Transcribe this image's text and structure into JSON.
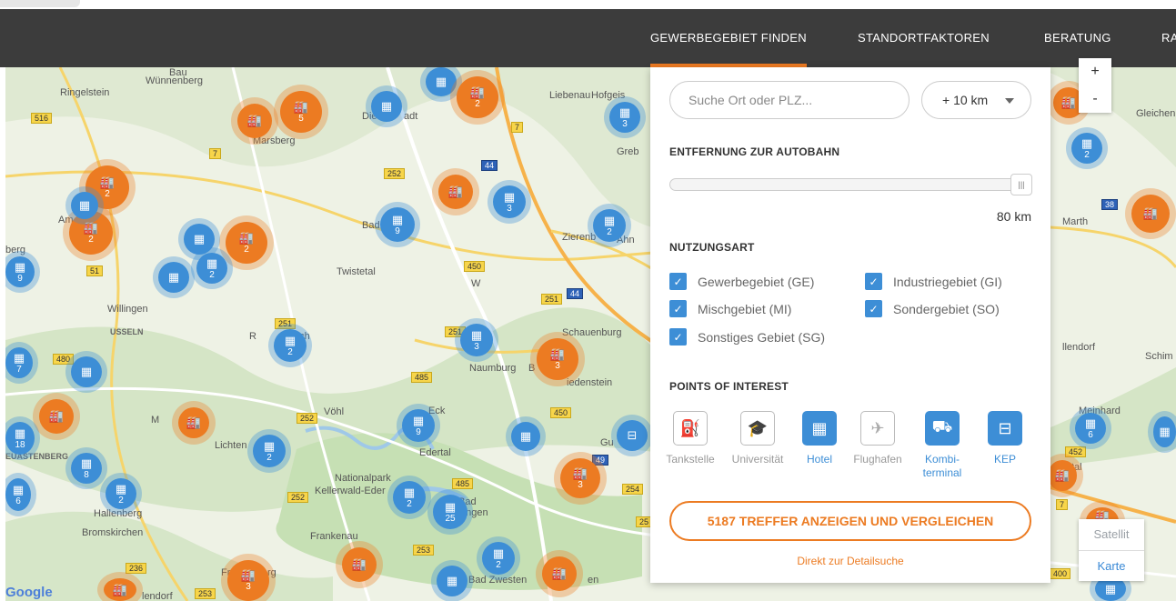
{
  "nav": {
    "items": [
      {
        "label": "GEWERBEGEBIET FINDEN",
        "active": true
      },
      {
        "label": "STANDORTFAKTOREN"
      },
      {
        "label": "BERATUNG"
      },
      {
        "label": "RA"
      }
    ]
  },
  "search": {
    "placeholder": "Suche Ort oder PLZ...",
    "radius": "+ 10 km"
  },
  "distance": {
    "title": "ENTFERNUNG ZUR AUTOBAHN",
    "handle": "|||",
    "value_label": "80 km",
    "fraction": 1.0
  },
  "usage": {
    "title": "NUTZUNGSART",
    "options": [
      {
        "label": "Gewerbegebiet (GE)",
        "checked": true
      },
      {
        "label": "Industriegebiet (GI)",
        "checked": true
      },
      {
        "label": "Mischgebiet (MI)",
        "checked": true
      },
      {
        "label": "Sondergebiet (SO)",
        "checked": true
      },
      {
        "label": "Sonstiges Gebiet (SG)",
        "checked": true
      }
    ]
  },
  "poi": {
    "title": "POINTS OF INTEREST",
    "items": [
      {
        "label": "Tankstelle",
        "active": false,
        "icon": "fuel-pump-icon"
      },
      {
        "label": "Universität",
        "active": false,
        "icon": "graduation-cap-icon"
      },
      {
        "label": "Hotel",
        "active": true,
        "icon": "hotel-icon"
      },
      {
        "label": "Flughafen",
        "active": false,
        "icon": "airplane-icon"
      },
      {
        "label": "Kombi-terminal",
        "line1": "Kombi-",
        "line2": "terminal",
        "active": true,
        "icon": "truck-icon"
      },
      {
        "label": "KEP",
        "active": true,
        "icon": "parcel-icon"
      }
    ]
  },
  "cta": {
    "label": "5187 TREFFER ANZEIGEN UND VERGLEICHEN"
  },
  "detail_link": {
    "label": "Direkt zur Detailsuche"
  },
  "map": {
    "zoom_in": "+",
    "zoom_out": "-",
    "type_satellite": "Satellit",
    "type_map": "Karte",
    "logo": "Google",
    "places": [
      "Bau",
      "Wünnenberg",
      "Ringelstein",
      "Liebenau",
      "Hofgeis",
      "Gleichen",
      "Marsberg",
      "Die",
      "adt",
      "Greb",
      "Bad",
      "Zierenb",
      "Ahn",
      "Marth",
      "Twistetal",
      "berg",
      "W",
      "Willingen",
      "USSELN",
      "Schauenburg",
      "ach",
      "llendorf",
      "Schim",
      "Naumburg",
      "B",
      "iedenstein",
      "Vöhl",
      "Eck",
      "Meinhard",
      "Lichten",
      "Edertal",
      "Gu",
      "EUASTENBERG",
      "Nationalpark",
      "Kellerwald-Eder",
      "Bad",
      "ungen",
      "Hallenberg",
      "Bromskirchen",
      "Frankenau",
      "Bad Zwesten",
      "lendorf",
      "Fr",
      "rg",
      "en",
      "Am",
      "R",
      "M",
      "tal"
    ],
    "roads": [
      {
        "label": "516",
        "color": "yellow"
      },
      {
        "label": "7",
        "color": "yellow"
      },
      {
        "label": "252",
        "color": "yellow"
      },
      {
        "label": "44",
        "color": "blue"
      },
      {
        "label": "7",
        "color": "yellow"
      },
      {
        "label": "450",
        "color": "yellow"
      },
      {
        "label": "251",
        "color": "yellow"
      },
      {
        "label": "44",
        "color": "blue"
      },
      {
        "label": "251",
        "color": "yellow"
      },
      {
        "label": "251",
        "color": "yellow"
      },
      {
        "label": "485",
        "color": "yellow"
      },
      {
        "label": "480",
        "color": "yellow"
      },
      {
        "label": "252",
        "color": "yellow"
      },
      {
        "label": "450",
        "color": "yellow"
      },
      {
        "label": "485",
        "color": "yellow"
      },
      {
        "label": "252",
        "color": "yellow"
      },
      {
        "label": "254",
        "color": "yellow"
      },
      {
        "label": "253",
        "color": "yellow"
      },
      {
        "label": "236",
        "color": "yellow"
      },
      {
        "label": "253",
        "color": "yellow"
      },
      {
        "label": "38",
        "color": "blue"
      },
      {
        "label": "452",
        "color": "yellow"
      },
      {
        "label": "7",
        "color": "yellow"
      },
      {
        "label": "400",
        "color": "yellow"
      },
      {
        "label": "51",
        "color": "yellow"
      },
      {
        "label": "49",
        "color": "blue"
      },
      {
        "label": "25",
        "color": "yellow"
      }
    ],
    "markers": [
      {
        "kind": "orange",
        "count": "5"
      },
      {
        "kind": "orange",
        "count": ""
      },
      {
        "kind": "blue",
        "count": ""
      },
      {
        "kind": "blue",
        "count": ""
      },
      {
        "kind": "orange",
        "count": "2"
      },
      {
        "kind": "blue",
        "count": "3"
      },
      {
        "kind": "orange",
        "count": ""
      },
      {
        "kind": "blue",
        "count": "2"
      },
      {
        "kind": "orange",
        "count": "2"
      },
      {
        "kind": "orange",
        "count": "2"
      },
      {
        "kind": "blue",
        "count": ""
      },
      {
        "kind": "orange",
        "count": "2"
      },
      {
        "kind": "blue",
        "count": "9"
      },
      {
        "kind": "orange",
        "count": ""
      },
      {
        "kind": "blue",
        "count": "3"
      },
      {
        "kind": "blue",
        "count": "2"
      },
      {
        "kind": "blue",
        "count": ""
      },
      {
        "kind": "blue",
        "count": "2"
      },
      {
        "kind": "blue",
        "count": ""
      },
      {
        "kind": "blue",
        "count": "9"
      },
      {
        "kind": "orange",
        "count": ""
      },
      {
        "kind": "blue",
        "count": "2"
      },
      {
        "kind": "blue",
        "count": "3"
      },
      {
        "kind": "orange",
        "count": "3"
      },
      {
        "kind": "blue",
        "count": "7"
      },
      {
        "kind": "blue",
        "count": ""
      },
      {
        "kind": "orange",
        "count": ""
      },
      {
        "kind": "orange",
        "count": ""
      },
      {
        "kind": "blue",
        "count": "18"
      },
      {
        "kind": "blue",
        "count": "9"
      },
      {
        "kind": "blue",
        "count": "2"
      },
      {
        "kind": "blue",
        "count": ""
      },
      {
        "kind": "blue",
        "count": ""
      },
      {
        "kind": "blue",
        "count": "8"
      },
      {
        "kind": "blue",
        "count": "6"
      },
      {
        "kind": "blue",
        "count": "2"
      },
      {
        "kind": "blue",
        "count": "2"
      },
      {
        "kind": "blue",
        "count": "25"
      },
      {
        "kind": "orange",
        "count": "3"
      },
      {
        "kind": "blue",
        "count": "6"
      },
      {
        "kind": "orange",
        "count": ""
      },
      {
        "kind": "orange",
        "count": ""
      },
      {
        "kind": "blue",
        "count": "2"
      },
      {
        "kind": "blue",
        "count": ""
      },
      {
        "kind": "orange",
        "count": "3"
      },
      {
        "kind": "orange",
        "count": ""
      },
      {
        "kind": "orange",
        "count": ""
      },
      {
        "kind": "blue",
        "count": ""
      },
      {
        "kind": "orange",
        "count": "2"
      },
      {
        "kind": "blue",
        "count": ""
      }
    ]
  },
  "colors": {
    "accent": "#ec7b22",
    "hotel_blue": "#3d8ed6",
    "navbar": "#3c3c3c"
  }
}
